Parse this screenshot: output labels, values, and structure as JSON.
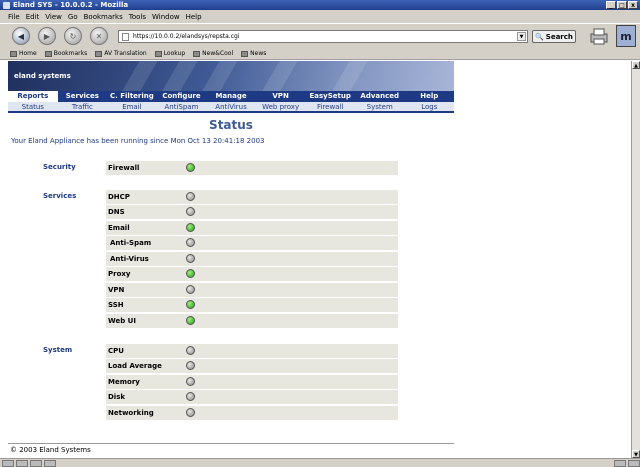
{
  "window": {
    "title": "Eland SYS - 10.0.0.2 - Mozilla",
    "controls": [
      "_",
      "□",
      "x"
    ]
  },
  "menubar": [
    "File",
    "Edit",
    "View",
    "Go",
    "Bookmarks",
    "Tools",
    "Window",
    "Help"
  ],
  "navigation": {
    "url": "https://10.0.0.2/elandsys/repsta.cgi",
    "search_label": "Search"
  },
  "bookmarks": [
    "Home",
    "Bookmarks",
    "AV Translation",
    "Lookup",
    "New&Cool",
    "News"
  ],
  "app": {
    "brand": "eland systems",
    "tabs_main": [
      "Reports",
      "Services",
      "C. Filtering",
      "Configure",
      "Manage",
      "VPN",
      "EasySetup",
      "Advanced",
      "Help"
    ],
    "tabs_sub": [
      "Status",
      "Traffic",
      "Email",
      "AntiSpam",
      "AntiVirus",
      "Web proxy",
      "Firewall",
      "System",
      "Logs"
    ],
    "page_title": "Status",
    "running_text": "Your Eland Appliance has been running since Mon Oct 13 20:41:18 2003",
    "sections": [
      {
        "title": "Security",
        "items": [
          {
            "label": "Firewall",
            "status": "on"
          }
        ]
      },
      {
        "title": "Services",
        "items": [
          {
            "label": "DHCP",
            "status": "off"
          },
          {
            "label": "DNS",
            "status": "off"
          },
          {
            "label": "Email",
            "status": "on"
          },
          {
            "label": "Anti-Spam",
            "status": "off"
          },
          {
            "label": "Anti-Virus",
            "status": "off"
          },
          {
            "label": "Proxy",
            "status": "on"
          },
          {
            "label": "VPN",
            "status": "off"
          },
          {
            "label": "SSH",
            "status": "on"
          },
          {
            "label": "Web UI",
            "status": "on"
          }
        ]
      },
      {
        "title": "System",
        "items": [
          {
            "label": "CPU",
            "status": "off"
          },
          {
            "label": "Load Average",
            "status": "off"
          },
          {
            "label": "Memory",
            "status": "off"
          },
          {
            "label": "Disk",
            "status": "off"
          },
          {
            "label": "Networking",
            "status": "off"
          }
        ]
      }
    ],
    "footer": "© 2003 Eland Systems"
  },
  "colors": {
    "accent": "#1f3a84",
    "led_on": "#22a01a",
    "led_off": "#8a8a8a",
    "row_bg": "#e8e7df"
  }
}
